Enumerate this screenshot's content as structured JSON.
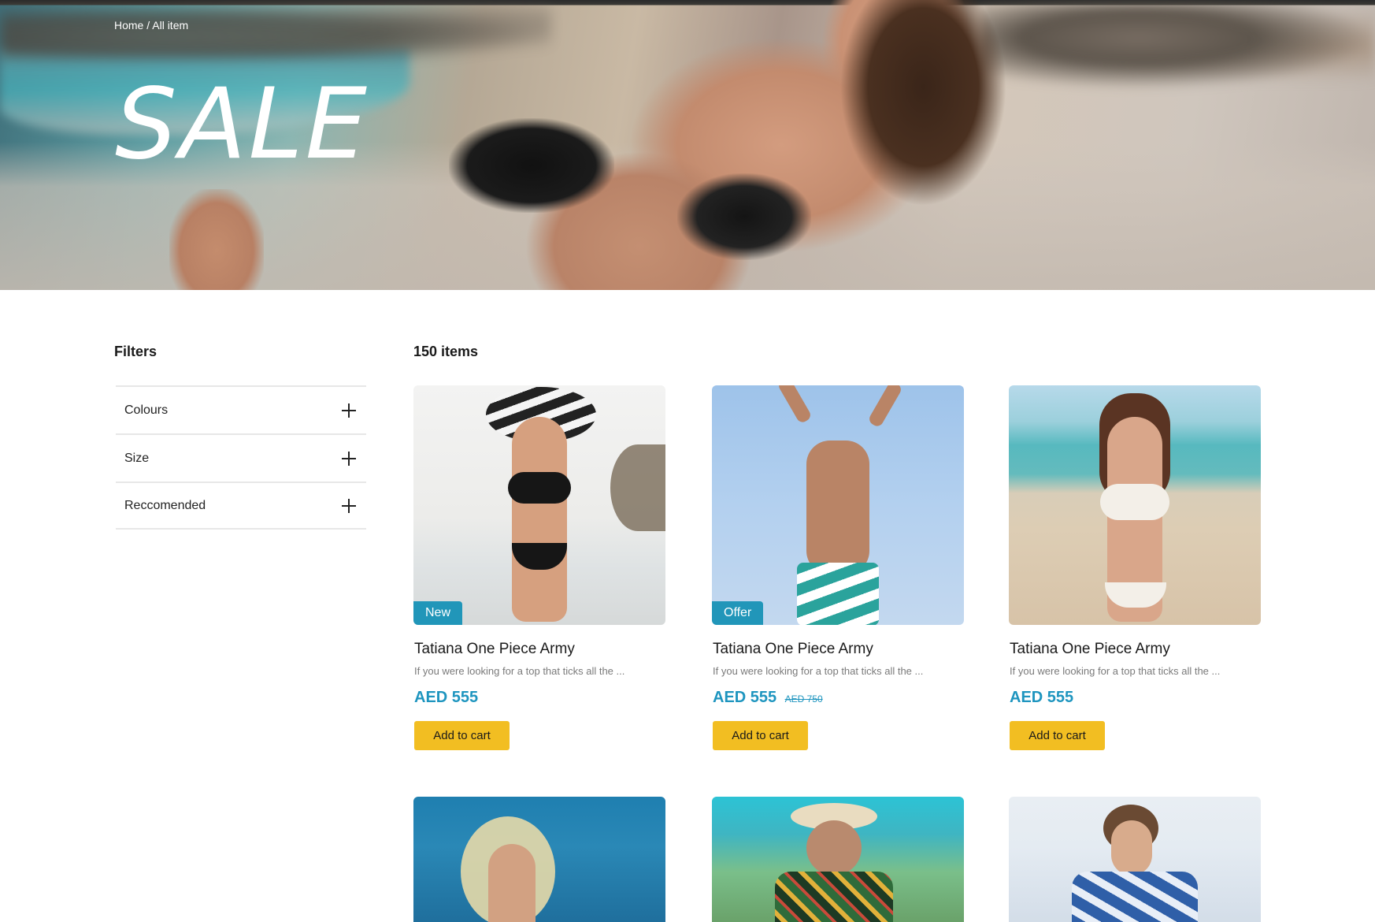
{
  "breadcrumb": "Home / All item",
  "hero": {
    "title": "SALE"
  },
  "filters": {
    "title": "Filters",
    "items": [
      {
        "label": "Colours"
      },
      {
        "label": "Size"
      },
      {
        "label": "Reccomended"
      }
    ]
  },
  "products": {
    "count_label": "150 items",
    "items": [
      {
        "badge": "New",
        "title": "Tatiana One Piece Army",
        "description": "If you were looking for a top that ticks all the ...",
        "price": "AED 555",
        "old_price": "",
        "cart_label": "Add to cart"
      },
      {
        "badge": "Offer",
        "title": "Tatiana One Piece Army",
        "description": "If you were looking for a top that ticks all the ...",
        "price": "AED 555",
        "old_price": "AED 750",
        "cart_label": "Add to cart"
      },
      {
        "badge": "",
        "title": "Tatiana One Piece Army",
        "description": "If you were looking for a top that ticks all the ...",
        "price": "AED 555",
        "old_price": "",
        "cart_label": "Add to cart"
      }
    ]
  },
  "colors": {
    "accent_blue": "#1e95bf",
    "badge_blue": "#2196b9",
    "cart_yellow": "#f2be22"
  }
}
